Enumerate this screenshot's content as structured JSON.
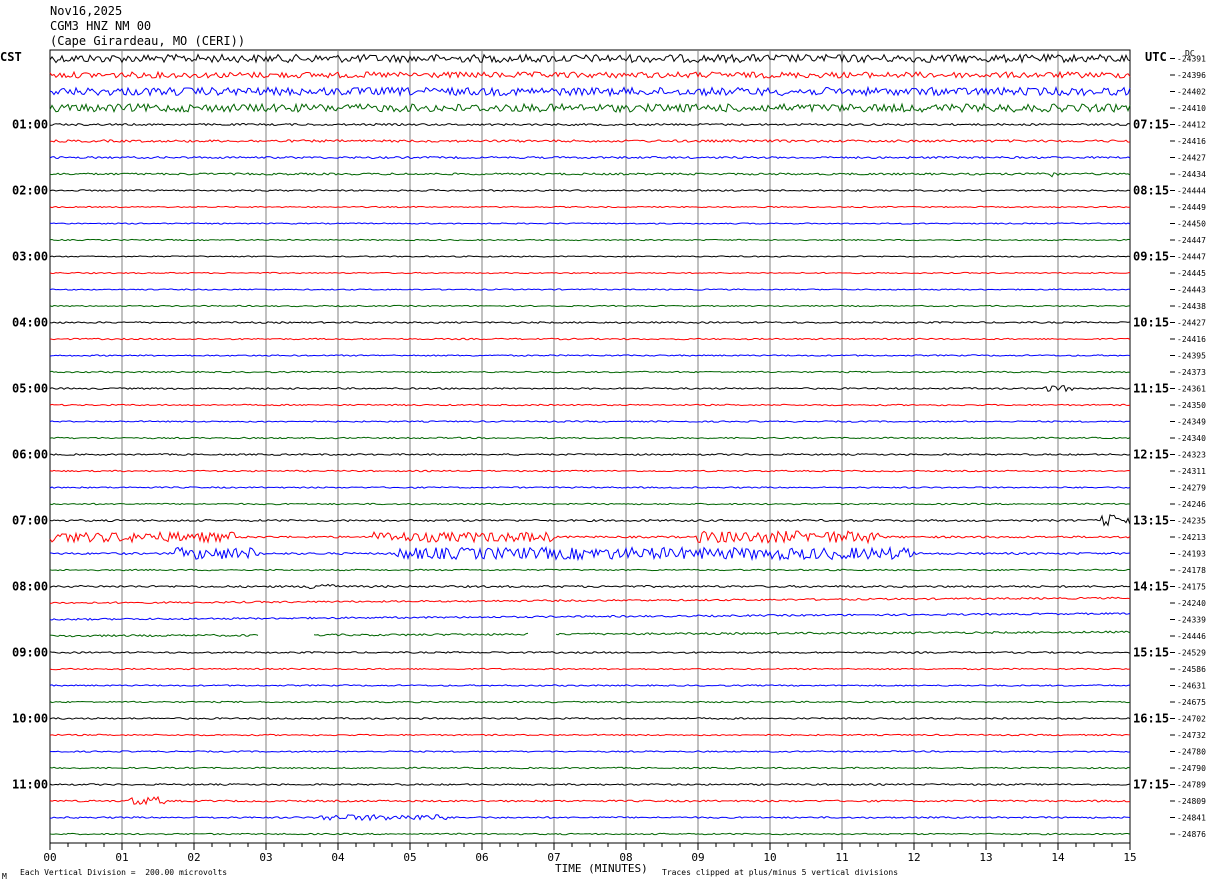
{
  "header": {
    "date": "Nov16,2025",
    "station": "CGM3 HNZ NM 00",
    "location": "(Cape Girardeau, MO (CERI))"
  },
  "left_tz": "CST",
  "right_tz": "UTC",
  "dc_label": "DC",
  "footer": {
    "scale_note": "Each Vertical Division =  200.00 microvolts",
    "clip_note": "Traces clipped at plus/minus 5 vertical divisions",
    "corner_mark": "M"
  },
  "colors": {
    "trace_cycle": [
      "#000000",
      "#ff0000",
      "#0000ff",
      "#006400"
    ],
    "grid": "#808080"
  },
  "chart_data": {
    "type": "line",
    "title": "CGM3 HNZ NM 00",
    "xlabel": "TIME (MINUTES)",
    "ylabel": "",
    "xlim": [
      0,
      15
    ],
    "x_ticks": [
      "00",
      "01",
      "02",
      "03",
      "04",
      "05",
      "06",
      "07",
      "08",
      "09",
      "10",
      "11",
      "12",
      "13",
      "14",
      "15"
    ],
    "left_hour_labels": [
      "01:00",
      "02:00",
      "03:00",
      "04:00",
      "05:00",
      "06:00",
      "07:00",
      "08:00",
      "09:00",
      "10:00",
      "11:00"
    ],
    "right_hour_labels": [
      "07:15",
      "08:15",
      "09:15",
      "10:15",
      "11:15",
      "12:15",
      "13:15",
      "14:15",
      "15:15",
      "16:15",
      "17:15"
    ],
    "trace_offsets": [
      -24391,
      -24396,
      -24402,
      -24410,
      -24412,
      -24416,
      -24427,
      -24434,
      -24444,
      -24449,
      -24450,
      -24447,
      -24447,
      -24445,
      -24443,
      -24438,
      -24427,
      -24416,
      -24395,
      -24373,
      -24361,
      -24350,
      -24349,
      -24340,
      -24323,
      -24311,
      -24279,
      -24246,
      -24235,
      -24213,
      -24193,
      -24178,
      -24175,
      -24240,
      -24339,
      -24446,
      -24529,
      -24586,
      -24631,
      -24675,
      -24702,
      -24732,
      -24780,
      -24790,
      -24789,
      -24809,
      -24841,
      -24876
    ],
    "trace_amplitude": [
      4,
      3,
      4,
      4,
      1,
      1.2,
      1,
      1,
      0.8,
      0.6,
      0.6,
      0.6,
      0.6,
      0.6,
      0.6,
      0.6,
      0.8,
      0.7,
      0.7,
      0.7,
      0.8,
      0.7,
      0.7,
      0.7,
      0.8,
      0.7,
      0.7,
      0.7,
      1,
      1,
      1,
      0.7,
      1,
      0.9,
      0.9,
      1,
      0.8,
      0.7,
      0.7,
      0.7,
      0.8,
      0.7,
      0.7,
      0.7,
      0.8,
      0.9,
      0.8,
      0.7
    ],
    "events": [
      {
        "trace": 28,
        "x_start": 14.6,
        "x_end": 15,
        "amp": 6
      },
      {
        "trace": 29,
        "x_start": 0.0,
        "x_end": 2.6,
        "amp": 5
      },
      {
        "trace": 29,
        "x_start": 4.5,
        "x_end": 7.0,
        "amp": 5
      },
      {
        "trace": 29,
        "x_start": 9.0,
        "x_end": 11.5,
        "amp": 6
      },
      {
        "trace": 30,
        "x_start": 1.7,
        "x_end": 2.9,
        "amp": 6
      },
      {
        "trace": 30,
        "x_start": 4.8,
        "x_end": 12.0,
        "amp": 6
      },
      {
        "trace": 32,
        "x_start": 3.6,
        "x_end": 3.95,
        "amp": 4
      },
      {
        "trace": 45,
        "x_start": 1.1,
        "x_end": 1.6,
        "amp": 4
      },
      {
        "trace": 46,
        "x_start": 3.7,
        "x_end": 5.5,
        "amp": 3
      },
      {
        "trace": 7,
        "x_start": 13.7,
        "x_end": 14.0,
        "amp": 3
      },
      {
        "trace": 20,
        "x_start": 13.8,
        "x_end": 14.2,
        "amp": 3
      }
    ],
    "gaps": [
      {
        "trace": 35,
        "x_start": 2.9,
        "x_end": 3.65
      },
      {
        "trace": 35,
        "x_start": 6.65,
        "x_end": 7.0
      }
    ],
    "drift": [
      {
        "trace": 33,
        "from": 0,
        "to": -5
      },
      {
        "trace": 34,
        "from": 0,
        "to": -6
      },
      {
        "trace": 35,
        "from": 0,
        "to": -4
      }
    ],
    "grid": true
  }
}
